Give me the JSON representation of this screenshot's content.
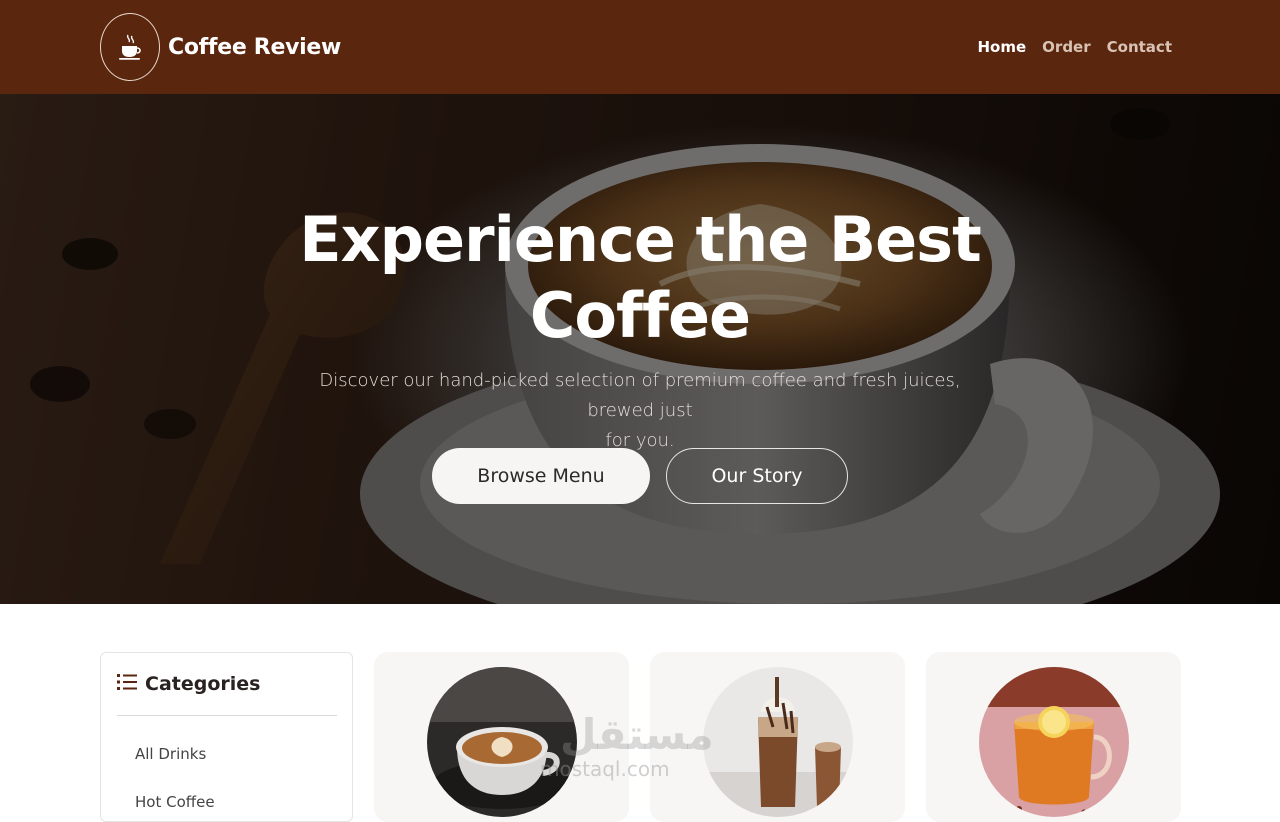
{
  "navbar": {
    "brand": "Coffee Review",
    "links": [
      {
        "label": "Home",
        "active": true
      },
      {
        "label": "Order",
        "active": false
      },
      {
        "label": "Contact",
        "active": false
      }
    ],
    "logo_icon": "coffee-cup-icon",
    "bg_color": "#5a260e"
  },
  "hero": {
    "title_line1": "Experience the Best",
    "title_line2": "Coffee",
    "subtitle_line1": "Discover our hand-picked selection of premium coffee and fresh juices, brewed just",
    "subtitle_line2": "for you.",
    "primary_button": "Browse Menu",
    "secondary_button": "Our Story",
    "background_image": "latte-art-cup"
  },
  "sidebar": {
    "title": "Categories",
    "icon": "list-icon",
    "items": [
      "All Drinks",
      "Hot Coffee"
    ]
  },
  "products": [
    {
      "image": "latte-cup-on-saucer"
    },
    {
      "image": "chocolate-milkshake-jars"
    },
    {
      "image": "orange-tea-glass"
    }
  ],
  "watermark": {
    "arabic": "مستقل",
    "latin": "mostaql.com"
  },
  "colors": {
    "brand": "#5a260e",
    "accent_text": "#ffffff"
  }
}
